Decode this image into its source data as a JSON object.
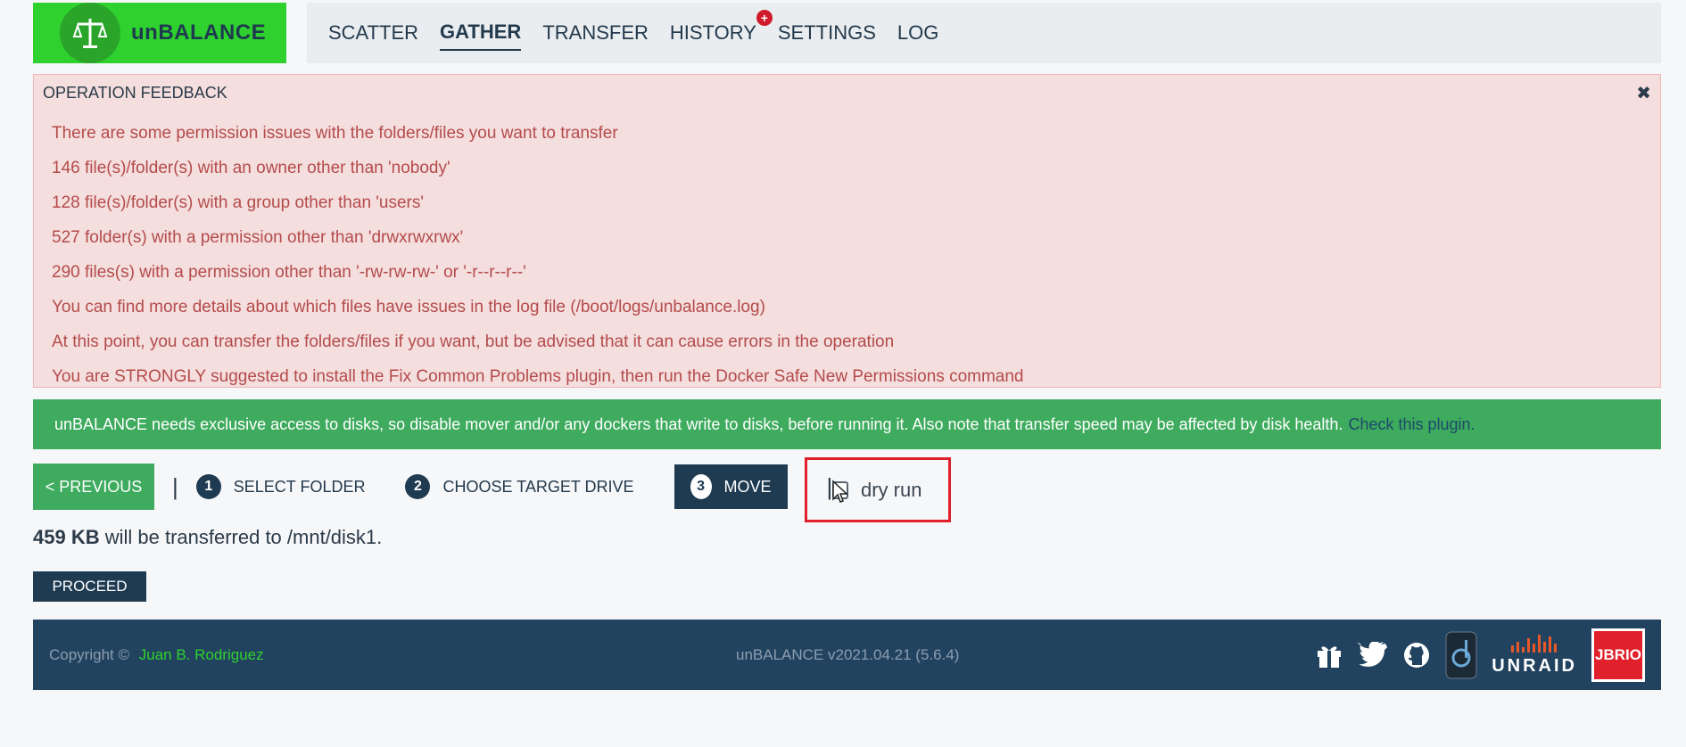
{
  "brand": {
    "name": "unBALANCE",
    "color": "#2fd12f"
  },
  "nav": {
    "items": [
      {
        "label": "SCATTER"
      },
      {
        "label": "GATHER",
        "active": true
      },
      {
        "label": "TRANSFER"
      },
      {
        "label": "HISTORY",
        "badge": "+"
      },
      {
        "label": "SETTINGS"
      },
      {
        "label": "LOG"
      }
    ]
  },
  "feedback": {
    "title": "OPERATION FEEDBACK",
    "close_icon": "close-icon",
    "lines": [
      "There are some permission issues with the folders/files you want to transfer",
      "146 file(s)/folder(s) with an owner other than 'nobody'",
      "128 file(s)/folder(s) with a group other than 'users'",
      "527 folder(s) with a permission other than 'drwxrwxrwx'",
      "290 files(s) with a permission other than '-rw-rw-rw-' or '-r--r--r--'",
      "You can find more details about which files have issues in the log file (/boot/logs/unbalance.log)",
      "At this point, you can transfer the folders/files if you want, but be advised that it can cause errors in the operation",
      "You are STRONGLY suggested to install the Fix Common Problems plugin, then run the Docker Safe New Permissions command"
    ]
  },
  "notice": {
    "text": "unBALANCE needs exclusive access to disks, so disable mover and/or any dockers that write to disks, before running it. Also note that transfer speed may be affected by disk health.",
    "link": "Check this plugin."
  },
  "steps": {
    "previous_label": "< PREVIOUS",
    "separator": "|",
    "items": [
      {
        "num": "1",
        "label": "SELECT FOLDER"
      },
      {
        "num": "2",
        "label": "CHOOSE TARGET DRIVE"
      },
      {
        "num": "3",
        "label": "MOVE",
        "active": true
      }
    ],
    "dry_run_label": "dry run",
    "dry_run_checked": false
  },
  "transfer": {
    "size": "459 KB",
    "text": " will be transferred to /mnt/disk1."
  },
  "proceed_label": "PROCEED",
  "footer": {
    "copyright_label": "Copyright ©",
    "author": "Juan B. Rodriguez",
    "version": "unBALANCE v2021.04.21 (5.6.4)",
    "icons": [
      "gift-icon",
      "twitter-icon",
      "github-icon",
      "app-icon",
      "unraid-logo",
      "jbrio-logo"
    ],
    "unraid_label": "UNRAID",
    "jbrio_label": "JBRIO"
  }
}
